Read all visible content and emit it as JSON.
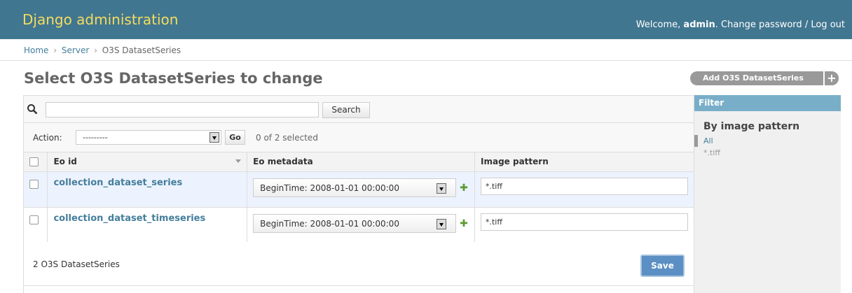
{
  "header": {
    "branding": "Django administration",
    "welcome_prefix": "Welcome, ",
    "username": "admin",
    "welcome_suffix": ".",
    "change_password": "Change password",
    "separator": "/",
    "logout": "Log out"
  },
  "breadcrumbs": {
    "home": "Home",
    "sep1": "›",
    "app": "Server",
    "sep2": "›",
    "current": "O3S DatasetSeries"
  },
  "page": {
    "title": "Select O3S DatasetSeries to change",
    "add_button": "Add O3S DatasetSeries",
    "add_icon": "+"
  },
  "search": {
    "value": "",
    "button": "Search"
  },
  "actions": {
    "label": "Action:",
    "selected_option": "---------",
    "go_button": "Go",
    "selection_counter": "0 of 2 selected"
  },
  "table": {
    "columns": [
      "Eo id",
      "Eo metadata",
      "Image pattern"
    ],
    "rows": [
      {
        "eo_id": "collection_dataset_series",
        "metadata": "BeginTime: 2008-01-01 00:00:00",
        "image_pattern": "*.tiff"
      },
      {
        "eo_id": "collection_dataset_timeseries",
        "metadata": "BeginTime: 2008-01-01 00:00:00",
        "image_pattern": "*.tiff"
      }
    ]
  },
  "footer": {
    "result_count": "2 O3S DatasetSeries",
    "save_button": "Save"
  },
  "filter": {
    "header": "Filter",
    "title": "By image pattern",
    "options": [
      "All",
      "*.tiff"
    ],
    "selected": "All"
  },
  "colors": {
    "header_bg": "#417690",
    "branding": "#f5dd5d",
    "link": "#447e9b",
    "filter_header": "#79aec8",
    "save_button": "#5c8fc3",
    "row_highlight": "#edf3fe"
  }
}
